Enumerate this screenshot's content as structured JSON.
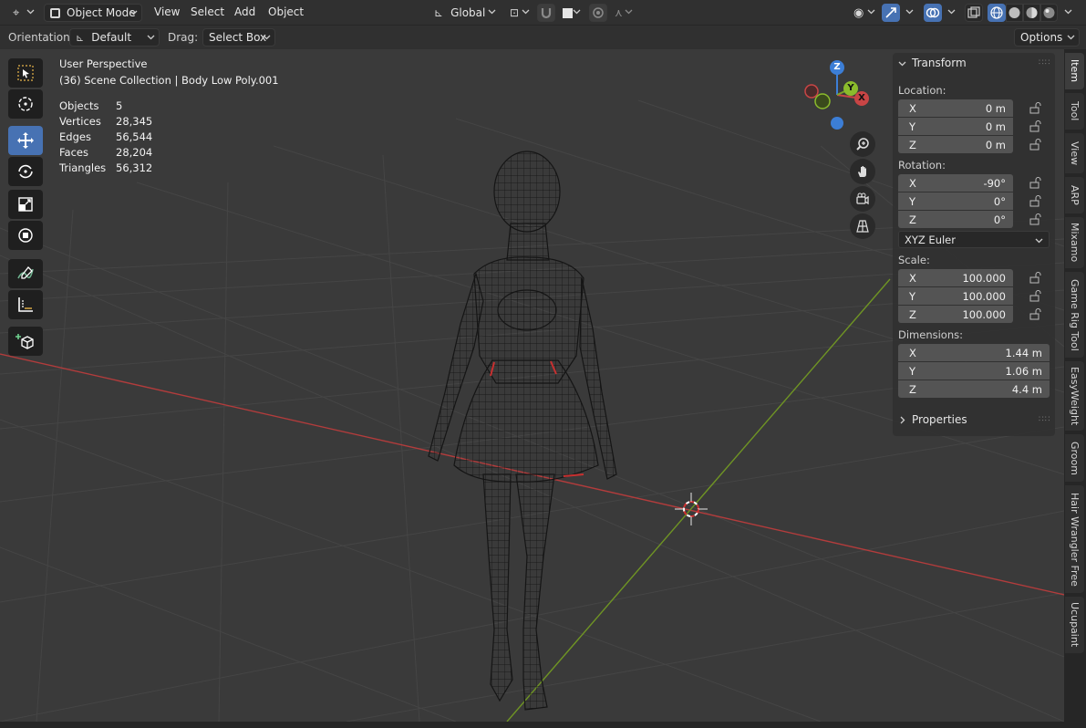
{
  "header": {
    "mode": "Object Mode",
    "menus": [
      "View",
      "Select",
      "Add",
      "Object"
    ],
    "transform_orientation": "Global"
  },
  "subheader": {
    "orientation_label": "Orientation:",
    "orientation_value": "Default",
    "drag_label": "Drag:",
    "drag_value": "Select Box",
    "options_label": "Options"
  },
  "overlay": {
    "view_name": "User Perspective",
    "collection": "(36) Scene Collection | Body Low Poly.001",
    "stats": [
      {
        "label": "Objects",
        "value": "5"
      },
      {
        "label": "Vertices",
        "value": "28,345"
      },
      {
        "label": "Edges",
        "value": "56,544"
      },
      {
        "label": "Faces",
        "value": "28,204"
      },
      {
        "label": "Triangles",
        "value": "56,312"
      }
    ]
  },
  "gizmo": {
    "x": "X",
    "y": "Y",
    "z": "Z"
  },
  "panel": {
    "transform_title": "Transform",
    "location_label": "Location:",
    "location": [
      {
        "axis": "X",
        "value": "0 m"
      },
      {
        "axis": "Y",
        "value": "0 m"
      },
      {
        "axis": "Z",
        "value": "0 m"
      }
    ],
    "rotation_label": "Rotation:",
    "rotation": [
      {
        "axis": "X",
        "value": "-90°"
      },
      {
        "axis": "Y",
        "value": "0°"
      },
      {
        "axis": "Z",
        "value": "0°"
      }
    ],
    "rotation_mode": "XYZ Euler",
    "scale_label": "Scale:",
    "scale": [
      {
        "axis": "X",
        "value": "100.000"
      },
      {
        "axis": "Y",
        "value": "100.000"
      },
      {
        "axis": "Z",
        "value": "100.000"
      }
    ],
    "dimensions_label": "Dimensions:",
    "dimensions": [
      {
        "axis": "X",
        "value": "1.44 m"
      },
      {
        "axis": "Y",
        "value": "1.06 m"
      },
      {
        "axis": "Z",
        "value": "4.4 m"
      }
    ],
    "properties_title": "Properties"
  },
  "tabs": [
    "Item",
    "Tool",
    "View",
    "ARP",
    "Mixamo",
    "Game Rig Tool",
    "EasyWeight",
    "Groom",
    "Hair Wrangler Free",
    "Ucupaint"
  ],
  "colors": {
    "accent": "#4772b3",
    "x_axis": "#c84545",
    "y_axis": "#7aa32a",
    "z_axis": "#3c7ed6"
  }
}
